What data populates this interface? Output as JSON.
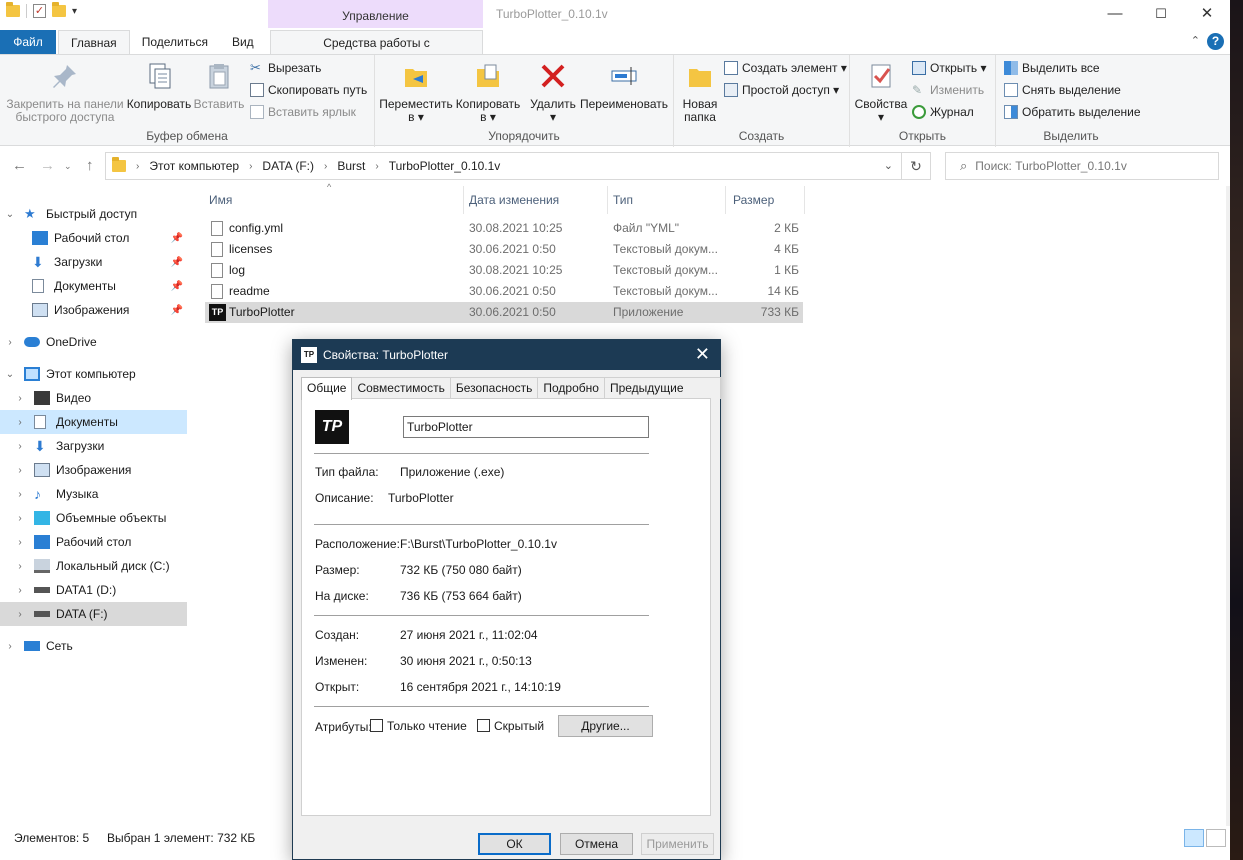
{
  "window": {
    "title": "TurboPlotter_0.10.1v",
    "context_group": "Управление",
    "controls": [
      "—",
      "☐",
      "✕"
    ]
  },
  "ribbon_tabs": {
    "file": "Файл",
    "home": "Главная",
    "share": "Поделиться",
    "view": "Вид",
    "app_tools": "Средства работы с приложениями"
  },
  "ribbon": {
    "clipboard": {
      "label": "Буфер обмена",
      "pin": "Закрепить на панели быстрого доступа",
      "pin_l1": "Закрепить на панели",
      "pin_l2": "быстрого доступа",
      "copy": "Копировать",
      "paste": "Вставить",
      "cut": "Вырезать",
      "copy_path": "Скопировать путь",
      "paste_shortcut": "Вставить ярлык"
    },
    "organize": {
      "label": "Упорядочить",
      "move_l1": "Переместить",
      "move_l2": "в ▾",
      "copy_l1": "Копировать",
      "copy_l2": "в ▾",
      "delete": "Удалить",
      "delete_arrow": "▾",
      "rename": "Переименовать"
    },
    "new": {
      "label": "Создать",
      "new_folder_l1": "Новая",
      "new_folder_l2": "папка",
      "new_item": "Создать элемент ▾",
      "easy_access": "Простой доступ ▾"
    },
    "open": {
      "label": "Открыть",
      "properties": "Свойства",
      "properties_arrow": "▾",
      "open": "Открыть ▾",
      "edit": "Изменить",
      "history": "Журнал"
    },
    "select": {
      "label": "Выделить",
      "select_all": "Выделить все",
      "select_none": "Снять выделение",
      "invert": "Обратить выделение"
    }
  },
  "address": {
    "crumbs": [
      "Этот компьютер",
      "DATA (F:)",
      "Burst",
      "TurboPlotter_0.10.1v"
    ],
    "search_placeholder": "Поиск: TurboPlotter_0.10.1v"
  },
  "nav": {
    "quick_access": "Быстрый доступ",
    "qa_items": [
      "Рабочий стол",
      "Загрузки",
      "Документы",
      "Изображения"
    ],
    "onedrive": "OneDrive",
    "this_pc": "Этот компьютер",
    "pc_items": [
      "Видео",
      "Документы",
      "Загрузки",
      "Изображения",
      "Музыка",
      "Объемные объекты",
      "Рабочий стол",
      "Локальный диск (C:)",
      "DATA1 (D:)",
      "DATA (F:)"
    ],
    "network": "Сеть"
  },
  "columns": {
    "name": "Имя",
    "date": "Дата изменения",
    "type": "Тип",
    "size": "Размер"
  },
  "files": [
    {
      "name": "config.yml",
      "date": "30.08.2021 10:25",
      "type": "Файл \"YML\"",
      "size": "2 КБ"
    },
    {
      "name": "licenses",
      "date": "30.06.2021 0:50",
      "type": "Текстовый докум...",
      "size": "4 КБ"
    },
    {
      "name": "log",
      "date": "30.08.2021 10:25",
      "type": "Текстовый докум...",
      "size": "1 КБ"
    },
    {
      "name": "readme",
      "date": "30.06.2021 0:50",
      "type": "Текстовый докум...",
      "size": "14 КБ"
    },
    {
      "name": "TurboPlotter",
      "date": "30.06.2021 0:50",
      "type": "Приложение",
      "size": "733 КБ"
    }
  ],
  "status": {
    "items": "Элементов: 5",
    "selected": "Выбран 1 элемент: 732 КБ"
  },
  "dialog": {
    "title": "Свойства: TurboPlotter",
    "icon_text": "TP",
    "tabs": [
      "Общие",
      "Совместимость",
      "Безопасность",
      "Подробно",
      "Предыдущие версии"
    ],
    "filename": "TurboPlotter",
    "file_type_label": "Тип файла:",
    "file_type": "Приложение (.exe)",
    "description_label": "Описание:",
    "description": "TurboPlotter",
    "location_label": "Расположение:",
    "location": "F:\\Burst\\TurboPlotter_0.10.1v",
    "size_label": "Размер:",
    "size": "732 КБ (750 080 байт)",
    "disk_label": "На диске:",
    "disk": "736 КБ (753 664 байт)",
    "created_label": "Создан:",
    "created": "27 июня 2021 г., 11:02:04",
    "modified_label": "Изменен:",
    "modified": "30 июня 2021 г., 0:50:13",
    "accessed_label": "Открыт:",
    "accessed": "16 сентября 2021 г., 14:10:19",
    "attributes_label": "Атрибуты:",
    "readonly": "Только чтение",
    "hidden": "Скрытый",
    "other": "Другие...",
    "ok": "ОК",
    "cancel": "Отмена",
    "apply": "Применить"
  }
}
